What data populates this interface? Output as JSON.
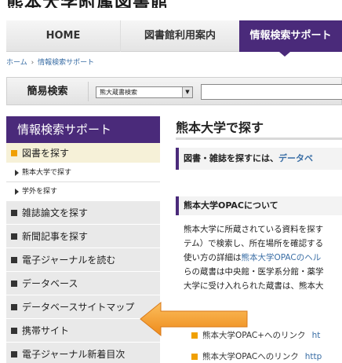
{
  "site": {
    "title": "熊本大学附属図書館"
  },
  "nav": {
    "home": "HOME",
    "guide": "図書館利用案内",
    "search_support": "情報検索サポート"
  },
  "breadcrumb": {
    "home": "ホーム",
    "separator": "›",
    "current": "情報検索サポート"
  },
  "simple_search": {
    "label": "簡易検索",
    "select_value": "熊大蔵書検索",
    "input_value": ""
  },
  "sidebar": {
    "heading": "情報検索サポート",
    "items": [
      {
        "label": "図書を探す",
        "active": true
      },
      {
        "label": "熊本大学で探す",
        "sub": true
      },
      {
        "label": "学外を探す",
        "sub": true
      },
      {
        "label": "雑誌論文を探す"
      },
      {
        "label": "新聞記事を探す"
      },
      {
        "label": "電子ジャーナルを読む"
      },
      {
        "label": "データベース"
      },
      {
        "label": "データベースサイトマップ"
      },
      {
        "label": "携帯サイト"
      },
      {
        "label": "電子ジャーナル新着目次"
      }
    ]
  },
  "content": {
    "title": "熊本大学で探す",
    "box_prefix": "図書・雑誌を探すには、",
    "box_link": "データベ",
    "section_title": "熊本大学OPACについて",
    "body_lines": [
      {
        "text": "熊本大学に所蔵されている資料を探す"
      },
      {
        "text": "テム）で検索し、所在場所を確認する"
      },
      {
        "text": "使い方の詳細は",
        "link": "熊本大学OPACのヘル"
      },
      {
        "text": "らの蔵書は中央館・医学系分館・薬学"
      },
      {
        "text": "大学に受け入れられた蔵書は、熊本大"
      }
    ],
    "links": [
      {
        "label": "熊本大学OPAC+へのリンク",
        "url": "ht"
      },
      {
        "label": "熊本大学OPACへのリンク",
        "url": "http"
      }
    ]
  },
  "colors": {
    "brand": "#4a2a7a",
    "accent": "#f0a000",
    "link": "#3a6ea5",
    "callout": "#f5a033"
  }
}
